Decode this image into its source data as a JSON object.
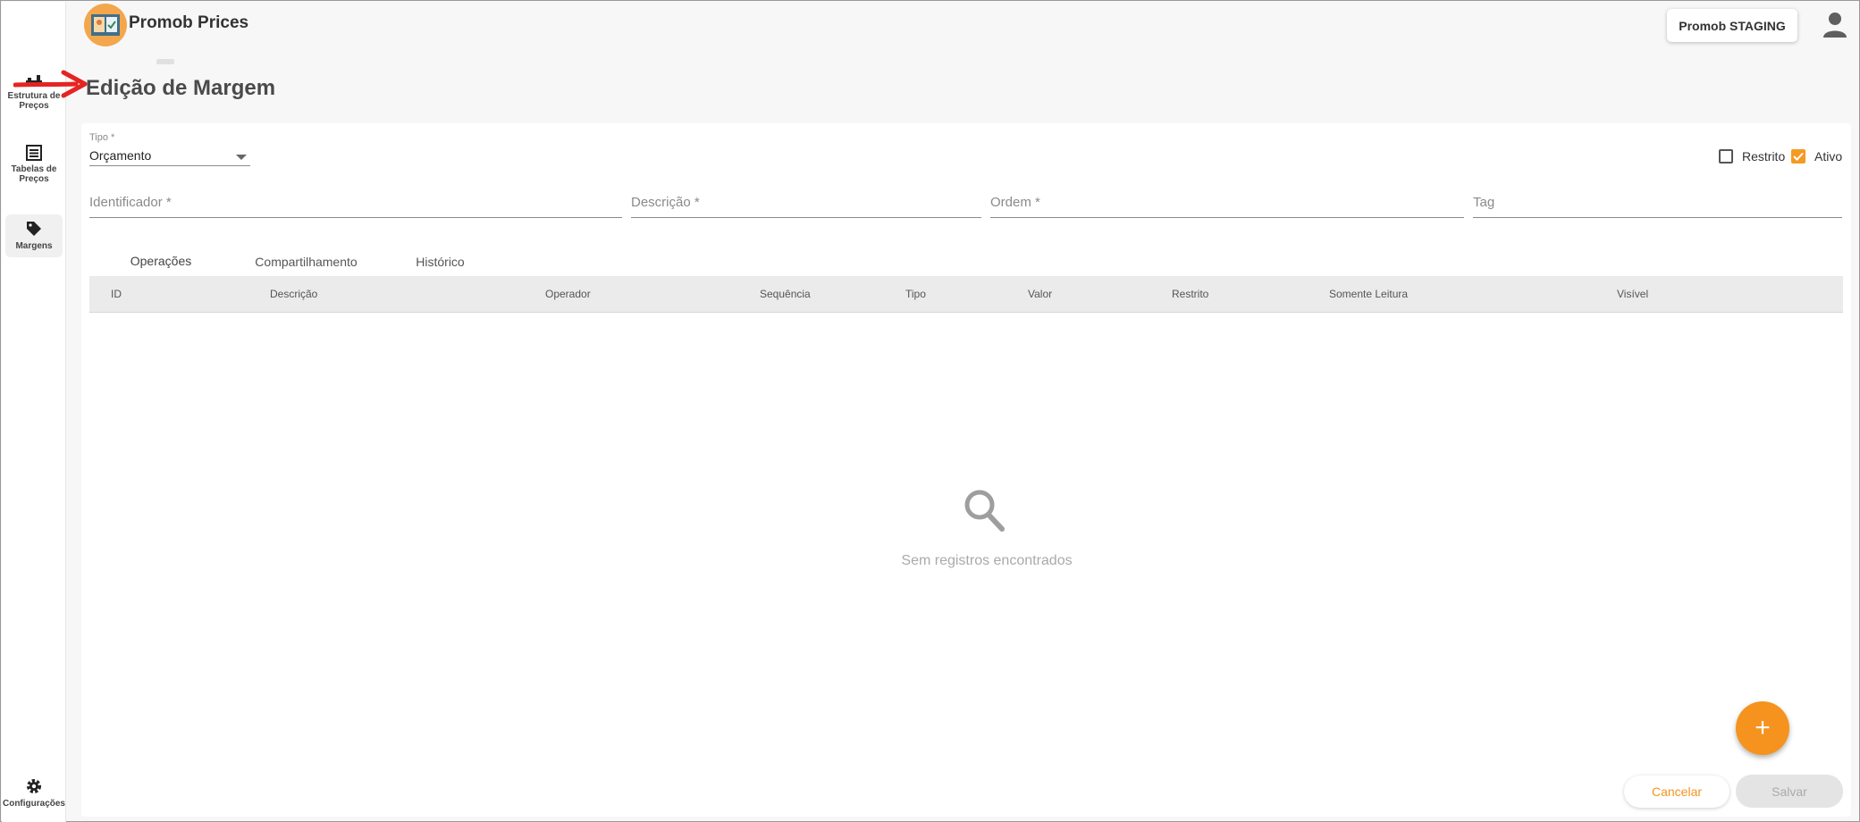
{
  "app": {
    "title": "Promob Prices",
    "environment": "Promob STAGING"
  },
  "sidebar": {
    "items": [
      {
        "label": "Estrutura de Preços",
        "icon": "structure-icon"
      },
      {
        "label": "Tabelas de Preços",
        "icon": "table-icon"
      },
      {
        "label": "Margens",
        "icon": "tag-icon",
        "active": true
      },
      {
        "label": "Configurações",
        "icon": "gear-icon"
      }
    ]
  },
  "page": {
    "title": "Edição de Margem"
  },
  "form": {
    "tipo": {
      "label": "Tipo *",
      "value": "Orçamento"
    },
    "restrito": {
      "label": "Restrito",
      "checked": false
    },
    "ativo": {
      "label": "Ativo",
      "checked": true
    },
    "identificador": {
      "label": "Identificador *"
    },
    "descricao": {
      "label": "Descrição *"
    },
    "ordem": {
      "label": "Ordem *"
    },
    "tag": {
      "label": "Tag"
    }
  },
  "tabs": [
    {
      "label": "Operações",
      "active": true
    },
    {
      "label": "Compartilhamento"
    },
    {
      "label": "Histórico"
    }
  ],
  "table": {
    "columns": [
      "ID",
      "Descrição",
      "Operador",
      "Sequência",
      "Tipo",
      "Valor",
      "Restrito",
      "Somente Leitura",
      "Visível"
    ],
    "empty_text": "Sem registros encontrados"
  },
  "actions": {
    "add": "+",
    "cancel": "Cancelar",
    "save": "Salvar"
  },
  "colors": {
    "accent": "#f5931e",
    "logo": "#f3a64b"
  }
}
